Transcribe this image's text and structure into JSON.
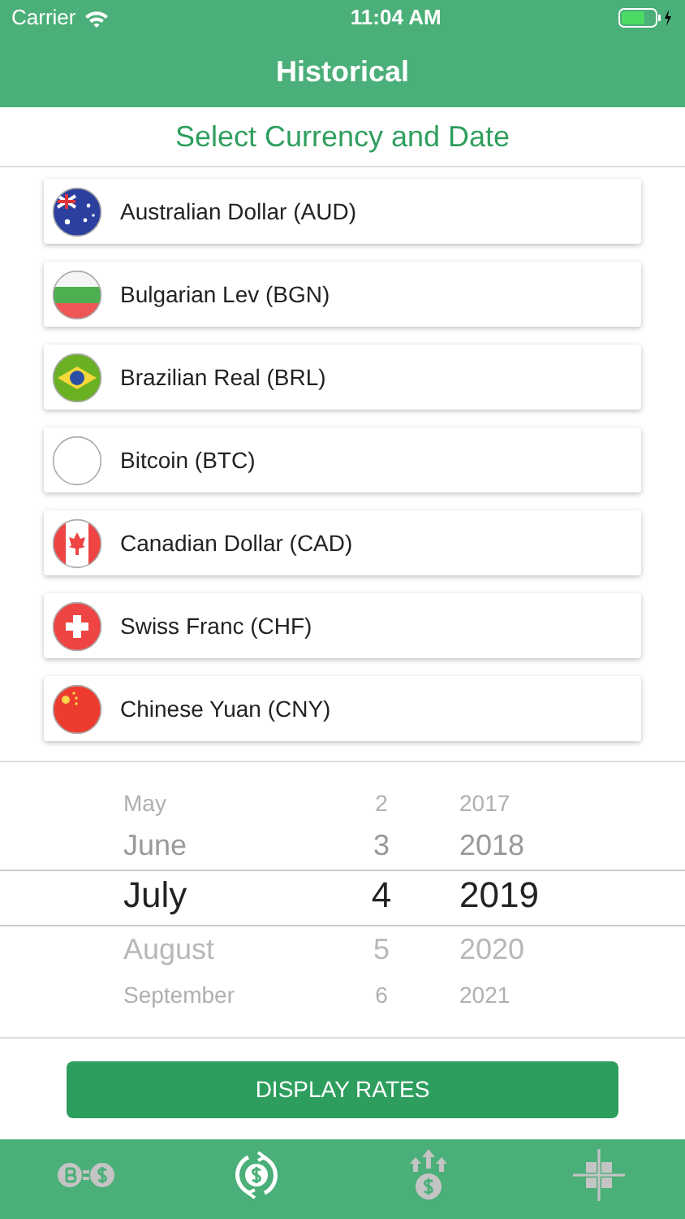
{
  "status_bar": {
    "carrier": "Carrier",
    "time": "11:04 AM"
  },
  "nav": {
    "title": "Historical"
  },
  "subtitle": "Select Currency and Date",
  "currencies": [
    {
      "name": "Australian Dollar (AUD)",
      "kind": "aud"
    },
    {
      "name": "Bulgarian Lev (BGN)",
      "kind": "bgn"
    },
    {
      "name": "Brazilian Real (BRL)",
      "kind": "brl"
    },
    {
      "name": "Bitcoin (BTC)",
      "kind": "btc"
    },
    {
      "name": "Canadian Dollar (CAD)",
      "kind": "cad"
    },
    {
      "name": "Swiss Franc (CHF)",
      "kind": "chf"
    },
    {
      "name": "Chinese Yuan (CNY)",
      "kind": "cny"
    }
  ],
  "date_picker": {
    "months": [
      {
        "label": "May",
        "selected": false
      },
      {
        "label": "June",
        "selected": false
      },
      {
        "label": "July",
        "selected": true
      },
      {
        "label": "August",
        "selected": false
      },
      {
        "label": "September",
        "selected": false
      }
    ],
    "days": [
      {
        "label": "2",
        "selected": false
      },
      {
        "label": "3",
        "selected": false
      },
      {
        "label": "4",
        "selected": true
      },
      {
        "label": "5",
        "selected": false
      },
      {
        "label": "6",
        "selected": false
      }
    ],
    "years": [
      {
        "label": "2017",
        "selected": false
      },
      {
        "label": "2018",
        "selected": false
      },
      {
        "label": "2019",
        "selected": true
      },
      {
        "label": "2020",
        "selected": false
      },
      {
        "label": "2021",
        "selected": false
      }
    ]
  },
  "button": "DISPLAY RATES",
  "tabs": [
    {
      "kind": "convert",
      "selected": false
    },
    {
      "kind": "historical",
      "selected": true
    },
    {
      "kind": "rise",
      "selected": false
    },
    {
      "kind": "grid",
      "selected": false
    }
  ]
}
